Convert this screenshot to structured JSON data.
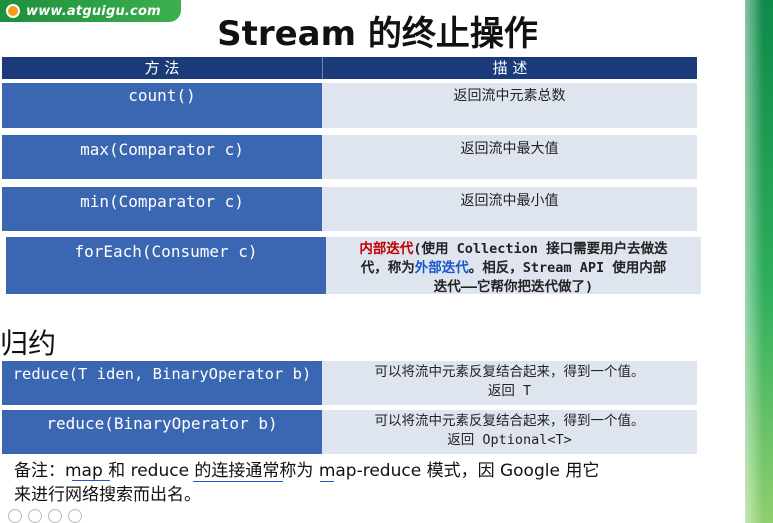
{
  "logo": {
    "url": "www.atguigu.com"
  },
  "title": "Stream 的终止操作",
  "table": {
    "headers": {
      "method": "方 法",
      "description": "描 述"
    },
    "rows": [
      {
        "method": "count()",
        "description": "返回流中元素总数"
      },
      {
        "method": "max(Comparator c)",
        "description": "返回流中最大值"
      },
      {
        "method": "min(Comparator c)",
        "description": "返回流中最小值"
      },
      {
        "method": "forEach(Consumer c)",
        "desc_red": "内部迭代",
        "desc_part1": "(使用 Collection 接口需要用户去做迭",
        "desc_part2": "代，称为",
        "desc_blue": "外部迭代",
        "desc_part3": "。相反，Stream API 使用内部",
        "desc_part4": "迭代——它帮你把迭代做了)"
      }
    ]
  },
  "section_title": "归约",
  "reduce_rows": [
    {
      "method": "reduce(T iden, BinaryOperator b)",
      "line1": "可以将流中元素反复结合起来，得到一个值。",
      "line2": "返回 T"
    },
    {
      "method": "reduce(BinaryOperator b)",
      "line1": "可以将流中元素反复结合起来，得到一个值。",
      "line2": "返回 Optional<T>"
    }
  ],
  "note": {
    "line1": "备注：map 和 reduce 的连接通常称为 map-reduce 模式，因 Google 用它",
    "line2": "来进行网络搜索而出名。"
  }
}
